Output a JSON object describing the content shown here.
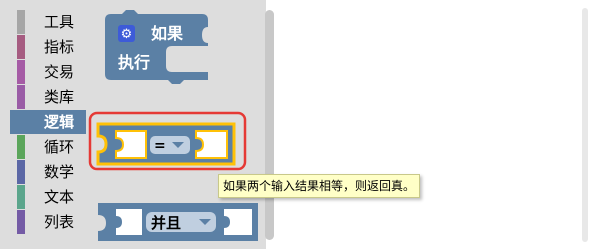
{
  "sidebar": {
    "categories": [
      {
        "label": "工具",
        "color": "#A6A6A6"
      },
      {
        "label": "指标",
        "color": "#A65C81"
      },
      {
        "label": "交易",
        "color": "#A55BA5"
      },
      {
        "label": "类库",
        "color": "#9A5CA6"
      },
      {
        "label": "逻辑",
        "color": "#5B80A5",
        "selected": true
      },
      {
        "label": "循环",
        "color": "#5BA55B"
      },
      {
        "label": "数学",
        "color": "#5B67A5"
      },
      {
        "label": "文本",
        "color": "#5BA58C"
      },
      {
        "label": "列表",
        "color": "#745BA5"
      }
    ]
  },
  "flyout": {
    "if_block": {
      "icon": "gear-icon",
      "line1": "如果",
      "line2": "执行",
      "color": "#5B80A5"
    },
    "compare_block": {
      "operator": "=",
      "color": "#5B80A5",
      "highlight_color": "#FFC107",
      "selection_color": "#E53935"
    },
    "and_block": {
      "operator": "并且",
      "color": "#5B80A5"
    }
  },
  "tooltip": {
    "text": "如果两个输入结果相等，则返回真。"
  }
}
